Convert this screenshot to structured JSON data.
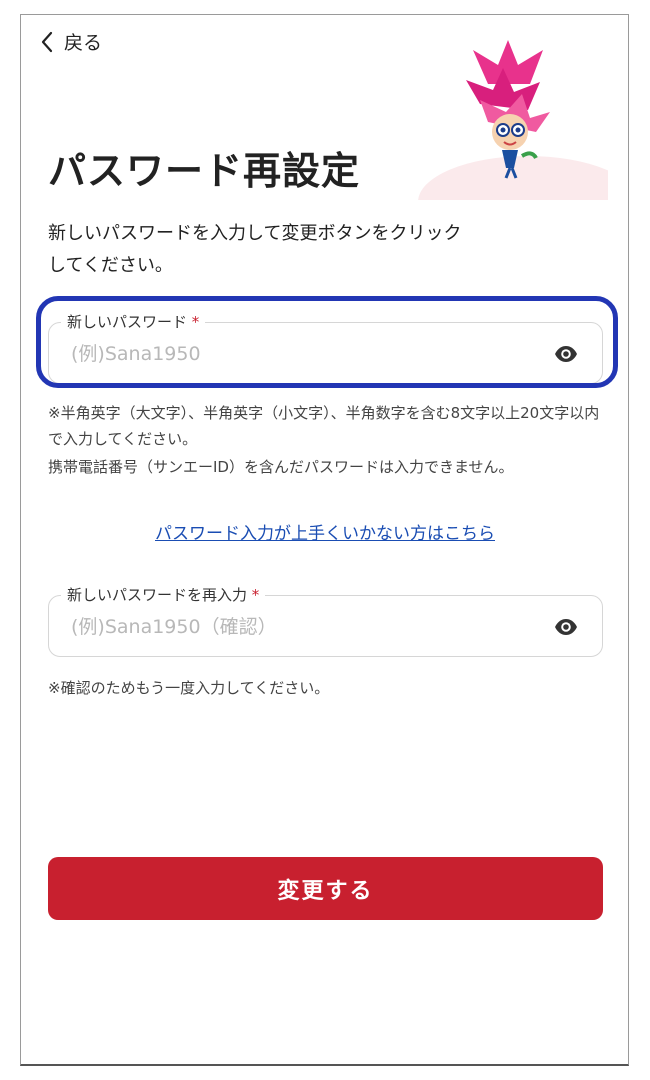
{
  "nav": {
    "back_label": "戻る"
  },
  "page": {
    "title": "パスワード再設定",
    "description": "新しいパスワードを入力して変更ボタンをクリックしてください。"
  },
  "new_password": {
    "label": "新しいパスワード",
    "required_mark": "*",
    "placeholder": "(例)Sana1950",
    "value": "",
    "note_rules": "※半角英字（大文字）、半角英字（小文字）、半角数字を含む8文字以上20文字以内で入力してください。",
    "note_phone": "携帯電話番号（サンエーID）を含んだパスワードは入力できません。"
  },
  "help_link": "パスワード入力が上手くいかない方はこちら",
  "confirm_password": {
    "label": "新しいパスワードを再入力",
    "required_mark": "*",
    "placeholder": "(例)Sana1950（確認）",
    "value": "",
    "note": "※確認のためもう一度入力してください。"
  },
  "submit_label": "変更する",
  "icons": {
    "back": "chevron-left-icon",
    "visibility": "eye-icon",
    "mascot": "flower-mascot-icon"
  },
  "colors": {
    "primary": "#c8202f",
    "link": "#1a4db3",
    "highlight": "#2236b4"
  }
}
